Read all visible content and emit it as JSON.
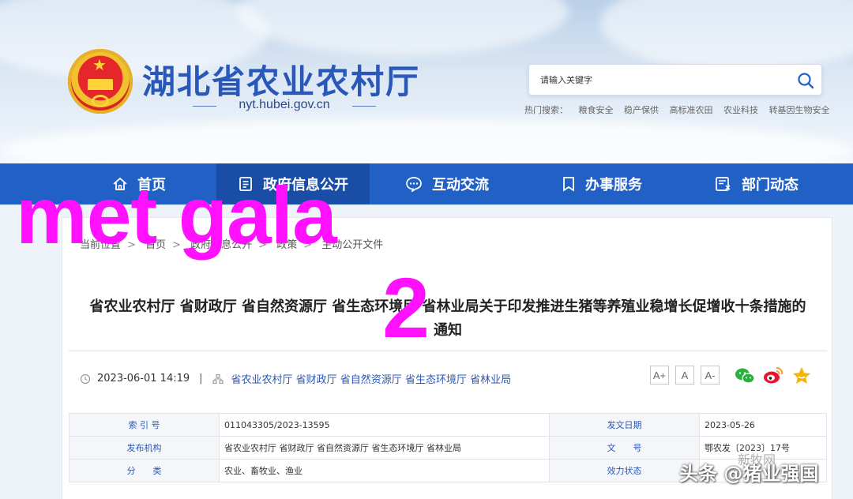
{
  "header": {
    "site_title": "湖北省农业农村厅",
    "site_url": "nyt.hubei.gov.cn",
    "search_placeholder": "请输入关键字",
    "hot_label": "热门搜索：",
    "hot_links": [
      "粮食安全",
      "稳产保供",
      "高标准农田",
      "农业科技",
      "转基因生物安全"
    ]
  },
  "nav": {
    "items": [
      {
        "label": "首页",
        "icon": "home-icon"
      },
      {
        "label": "政府信息公开",
        "icon": "document-icon"
      },
      {
        "label": "互动交流",
        "icon": "chat-icon"
      },
      {
        "label": "办事服务",
        "icon": "bookmark-icon"
      },
      {
        "label": "部门动态",
        "icon": "news-icon"
      }
    ],
    "active_index": 1
  },
  "breadcrumb": {
    "items": [
      "当前位置",
      "首页",
      "政府信息公开",
      "政策",
      "主动公开文件"
    ]
  },
  "article": {
    "title": "省农业农村厅 省财政厅 省自然资源厅 省生态环境厅 省林业局关于印发推进生猪等养殖业稳增长促增收十条措施的通知",
    "datetime": "2023-06-01 14:19",
    "publisher": "省农业农村厅 省财政厅 省自然资源厅 省生态环境厅 省林业局",
    "font_buttons": [
      "A+",
      "A",
      "A-"
    ]
  },
  "info_table": {
    "rows": [
      {
        "k1": "索 引 号",
        "v1": "011043305/2023-13595",
        "k2": "发文日期",
        "v2": "2023-05-26"
      },
      {
        "k1": "发布机构",
        "v1": "省农业农村厅 省财政厅 省自然资源厅 省生态环境厅 省林业局",
        "k2": "文　　号",
        "v2": "鄂农发〔2023〕17号"
      },
      {
        "k1": "分　　类",
        "v1": "农业、畜牧业、渔业",
        "k2": "效力状态",
        "v2": ""
      }
    ]
  },
  "overlays": {
    "text": "met gala",
    "number": "2",
    "watermark": "头条 @猪业强国",
    "faint_watermark": "新牧网"
  },
  "colors": {
    "nav_bg": "#2160c4",
    "nav_active": "#1a4ea6",
    "title_blue": "#2a58b8",
    "overlay_magenta": "#ff10ff"
  }
}
